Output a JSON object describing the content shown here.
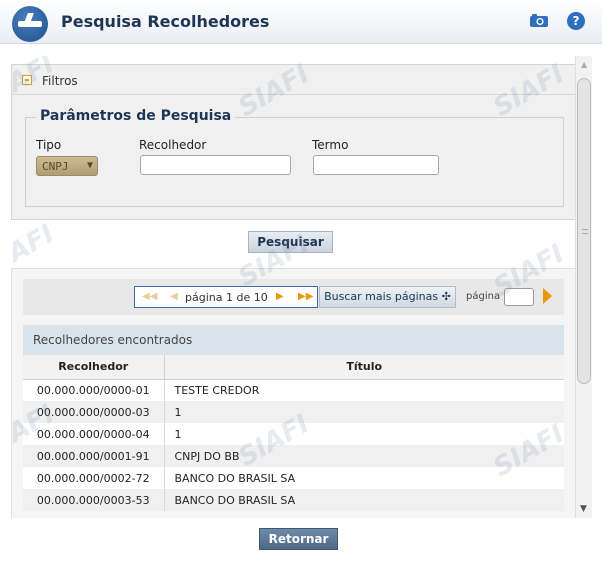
{
  "header": {
    "title": "Pesquisa Recolhedores",
    "help_glyph": "?"
  },
  "watermark": "SIAFI",
  "filters": {
    "label": "Filtros",
    "legend": "Parâmetros de Pesquisa",
    "tipo_label": "Tipo",
    "tipo_value": "CNPJ",
    "recolhedor_label": "Recolhedor",
    "recolhedor_value": "",
    "termo_label": "Termo",
    "termo_value": ""
  },
  "search_button": "Pesquisar",
  "pager": {
    "text": "página 1 de 10",
    "mais_label": "Buscar mais páginas",
    "pagina_label": "página",
    "page_value": ""
  },
  "results": {
    "title": "Recolhedores encontrados",
    "columns": [
      "Recolhedor",
      "Título"
    ],
    "rows": [
      [
        "00.000.000/0000-01",
        "TESTE CREDOR"
      ],
      [
        "00.000.000/0000-03",
        "1"
      ],
      [
        "00.000.000/0000-04",
        "1"
      ],
      [
        "00.000.000/0001-91",
        "CNPJ DO BB"
      ],
      [
        "00.000.000/0002-72",
        "BANCO DO BRASIL SA"
      ],
      [
        "00.000.000/0003-53",
        "BANCO DO BRASIL SA"
      ]
    ]
  },
  "return_button": "Retornar"
}
